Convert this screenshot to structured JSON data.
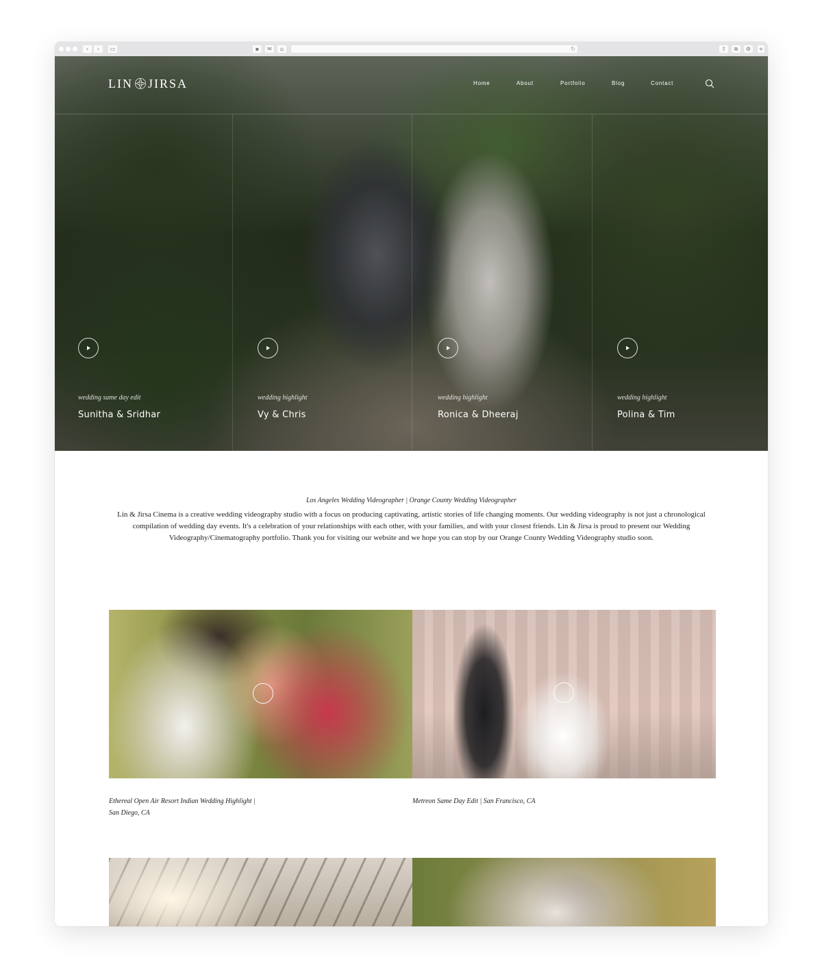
{
  "brand": {
    "name_left": "LIN",
    "name_right": "JIRSA"
  },
  "nav": {
    "items": [
      {
        "label": "Home"
      },
      {
        "label": "About"
      },
      {
        "label": "Portfolio"
      },
      {
        "label": "Blog"
      },
      {
        "label": "Contact"
      }
    ]
  },
  "hero_cards": [
    {
      "type": "wedding same day edit",
      "title": "Sunitha & Sridhar"
    },
    {
      "type": "wedding highlight",
      "title": "Vy & Chris"
    },
    {
      "type": "wedding highlight",
      "title": "Ronica & Dheeraj"
    },
    {
      "type": "wedding highlight",
      "title": "Polina & Tim"
    }
  ],
  "intro": {
    "subtitle": "Los Angeles Wedding Videographer | Orange County Wedding Videographer",
    "body": "Lin & Jirsa Cinema is a creative wedding videography studio with a focus on producing captivating, artistic stories of life changing moments. Our wedding videography is not just a chronological compilation of wedding day events. It's a celebration of your relationships with each other, with your families, and with your closest friends. Lin & Jirsa is proud to present our Wedding Videography/Cinematography portfolio. Thank you for visiting our website and we hope you can stop by our Orange County Wedding Videography studio soon."
  },
  "portfolio": [
    {
      "caption_line1": "Ethereal Open Air Resort Indian Wedding Highlight |",
      "caption_line2": "San Diego, CA"
    },
    {
      "caption_line1": "Metreon Same Day Edit | San Francisco, CA",
      "caption_line2": ""
    }
  ],
  "colors": {
    "text": "#222222",
    "overlay_text": "#ffffff",
    "browser_chrome": "#e4e4e6"
  },
  "icons": [
    "search-icon",
    "play-icon",
    "lotus-logo-icon",
    "back-icon",
    "forward-icon",
    "home-icon",
    "reload-icon"
  ]
}
